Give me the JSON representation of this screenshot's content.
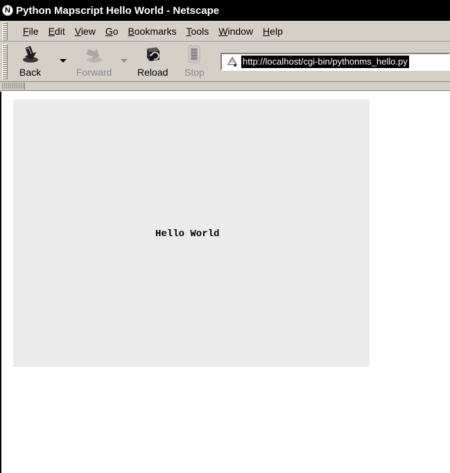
{
  "window": {
    "title": "Python Mapscript Hello World - Netscape"
  },
  "menu": {
    "items": [
      {
        "key": "F",
        "rest": "ile"
      },
      {
        "key": "E",
        "rest": "dit"
      },
      {
        "key": "V",
        "rest": "iew"
      },
      {
        "key": "G",
        "rest": "o"
      },
      {
        "key": "B",
        "rest": "ookmarks"
      },
      {
        "key": "T",
        "rest": "ools"
      },
      {
        "key": "W",
        "rest": "indow"
      },
      {
        "key": "H",
        "rest": "elp"
      }
    ]
  },
  "toolbar": {
    "back_label": "Back",
    "forward_label": "Forward",
    "reload_label": "Reload",
    "stop_label": "Stop",
    "forward_enabled": false,
    "stop_enabled": false
  },
  "address": {
    "url": "http://localhost/cgi-bin/pythonms_hello.py"
  },
  "page": {
    "map_text": "Hello World",
    "map_background": "#ebebeb"
  }
}
